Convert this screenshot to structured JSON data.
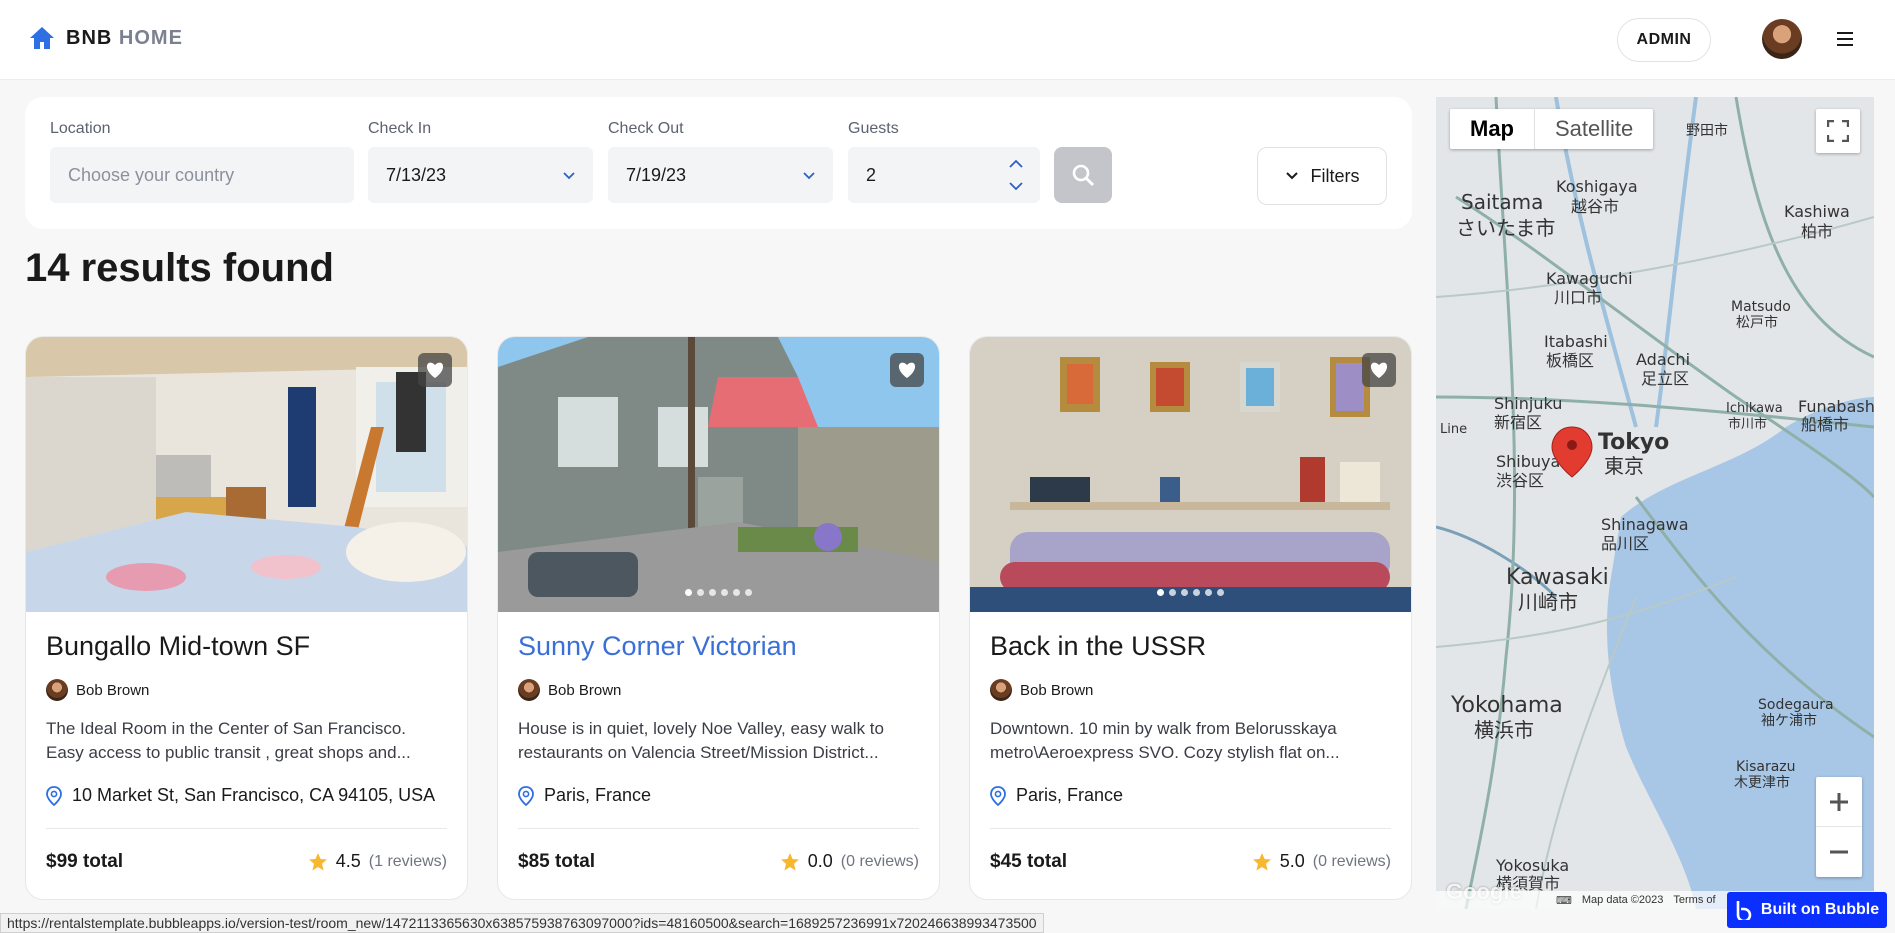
{
  "header": {
    "logo_bold": "BNB",
    "logo_light": "HOME",
    "admin_label": "ADMIN"
  },
  "search": {
    "location_label": "Location",
    "location_placeholder": "Choose your country",
    "checkin_label": "Check In",
    "checkin_value": "7/13/23",
    "checkout_label": "Check Out",
    "checkout_value": "7/19/23",
    "guests_label": "Guests",
    "guests_value": "2",
    "filters_label": "Filters"
  },
  "results": {
    "title": "14 results found"
  },
  "listings": [
    {
      "title": "Bungallo Mid-town SF",
      "host": "Bob Brown",
      "description": "The Ideal Room in the Center of San Francisco. Easy access to public transit , great shops and...",
      "location": "10 Market St, San Francisco, CA 94105, USA",
      "price": "$99 total",
      "rating": "4.5",
      "reviews": "(1 reviews)"
    },
    {
      "title": "Sunny Corner Victorian",
      "host": "Bob Brown",
      "description": "House is in quiet, lovely Noe Valley, easy walk to restaurants on Valencia Street/Mission District...",
      "location": "Paris, France",
      "price": "$85 total",
      "rating": "0.0",
      "reviews": "(0 reviews)"
    },
    {
      "title": "Back in the USSR",
      "host": "Bob Brown",
      "description": "Downtown. 10 min by walk from Belorusskaya metro\\Aeroexpress SVO. Cozy stylish flat on...",
      "location": "Paris, France",
      "price": "$45 total",
      "rating": "5.0",
      "reviews": "(0 reviews)"
    }
  ],
  "map": {
    "tab_map": "Map",
    "tab_satellite": "Satellite",
    "data_credit": "Map data ©2023",
    "terms": "Terms of",
    "labels": {
      "saitama": "Saitama",
      "saitama_jp": "さいたま市",
      "koshigaya": "Koshigaya",
      "koshigaya_jp": "越谷市",
      "kashiwa": "Kashiwa",
      "kashiwa_jp": "柏市",
      "kawaguchi": "Kawaguchi",
      "kawaguchi_jp": "川口市",
      "matsudo": "Matsudo",
      "matsudo_jp": "松戸市",
      "itabashi": "Itabashi",
      "itabashi_jp": "板橋区",
      "adachi": "Adachi",
      "adachi_jp": "足立区",
      "shinjuku": "Shinjuku",
      "shinjuku_jp": "新宿区",
      "ichikawa": "Ichikawa",
      "ichikawa_jp": "市川市",
      "funabashi": "Funabashi",
      "funabashi_jp": "船橋市",
      "tokyo": "Tokyo",
      "tokyo_jp": "東京",
      "shibuya": "Shibuya",
      "shibuya_jp": "渋谷区",
      "shinagawa": "Shinagawa",
      "shinagawa_jp": "品川区",
      "kawasaki": "Kawasaki",
      "kawasaki_jp": "川崎市",
      "yokohama": "Yokohama",
      "yokohama_jp": "横浜市",
      "sodegaura": "Sodegaura",
      "sodegaura_jp": "袖ケ浦市",
      "kisarazu": "Kisarazu",
      "kisarazu_jp": "木更津市",
      "yokosuka": "Yokosuka",
      "yokosuka_jp": "横須賀市",
      "noda_jp": "野田市",
      "line_label": "Line"
    }
  },
  "bubble_badge": "Built on Bubble",
  "status_url": "https://rentalstemplate.bubbleapps.io/version-test/room_new/1472113365630x638575938763097000?ids=48160500&search=1689257236991x720246638993473500",
  "colors": {
    "accent_blue": "#3b6fd8",
    "bubble_blue": "#0a2fff",
    "star": "#f5b82e",
    "pin": "#e23b30"
  }
}
